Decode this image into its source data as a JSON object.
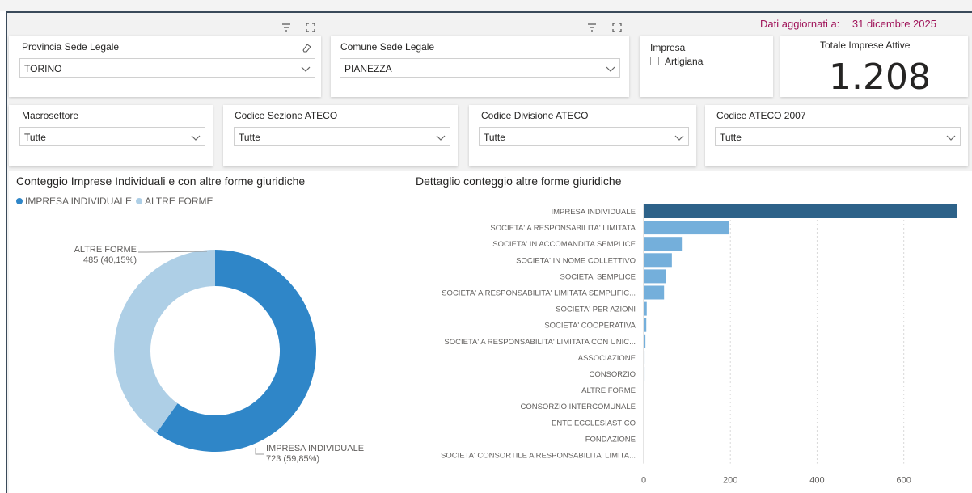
{
  "header": {
    "updated_label": "Dati aggiornati a:",
    "updated_date": "31 dicembre 2025"
  },
  "filters": {
    "provincia": {
      "label": "Provincia Sede Legale",
      "value": "TORINO"
    },
    "comune": {
      "label": "Comune Sede Legale",
      "value": "PIANEZZA"
    },
    "impresa": {
      "label": "Impresa",
      "checkbox_label": "Artigiana",
      "checked": false
    },
    "macrosettore": {
      "label": "Macrosettore",
      "value": "Tutte"
    },
    "sezione": {
      "label": "Codice Sezione ATECO",
      "value": "Tutte"
    },
    "divisione": {
      "label": "Codice Divisione ATECO",
      "value": "Tutte"
    },
    "ateco2007": {
      "label": "Codice ATECO 2007",
      "value": "Tutte"
    }
  },
  "kpi": {
    "title": "Totale Imprese Attive",
    "value": "1.208"
  },
  "icons": {
    "filter": "filter-icon",
    "focus": "focus-mode-icon",
    "eraser": "eraser-icon",
    "chevron": "chevron-down-icon"
  },
  "colors": {
    "accent_date": "#a0145a",
    "impresa_individuale": "#2f86c8",
    "altre_forme": "#aecfe6",
    "bar_highlight": "#2d6289",
    "bar_default": "#74afdb"
  },
  "chart_data": [
    {
      "type": "pie",
      "title": "Conteggio Imprese Individuali e con altre forme giuridiche",
      "legend_position": "top-left",
      "legend": [
        "IMPRESA INDIVIDUALE",
        "ALTRE FORME"
      ],
      "slices": [
        {
          "name": "IMPRESA INDIVIDUALE",
          "value": 723,
          "label_value": "723 (59,85%)"
        },
        {
          "name": "ALTRE FORME",
          "value": 485,
          "label_value": "485 (40,15%)"
        }
      ]
    },
    {
      "type": "bar",
      "orientation": "horizontal",
      "title": "Dettaglio conteggio altre forme giuridiche",
      "grid": true,
      "xlim": [
        0,
        720
      ],
      "xticks": [
        "0",
        "200",
        "400",
        "600"
      ],
      "xtick_values": [
        0,
        200,
        400,
        600
      ],
      "categories": [
        "IMPRESA INDIVIDUALE",
        "SOCIETA' A RESPONSABILITA' LIMITATA",
        "SOCIETA' IN ACCOMANDITA SEMPLICE",
        "SOCIETA' IN NOME COLLETTIVO",
        "SOCIETA' SEMPLICE",
        "SOCIETA' A RESPONSABILITA' LIMITATA SEMPLIFIC...",
        "SOCIETA' PER AZIONI",
        "SOCIETA' COOPERATIVA",
        "SOCIETA' A RESPONSABILITA' LIMITATA CON UNIC...",
        "ASSOCIAZIONE",
        "CONSORZIO",
        "ALTRE FORME",
        "CONSORZIO INTERCOMUNALE",
        "ENTE ECCLESIASTICO",
        "FONDAZIONE",
        "SOCIETA' CONSORTILE A RESPONSABILITA' LIMITA..."
      ],
      "values": [
        723,
        197,
        88,
        65,
        52,
        47,
        7,
        6,
        4,
        2,
        2,
        1,
        1,
        1,
        1,
        1
      ]
    }
  ]
}
